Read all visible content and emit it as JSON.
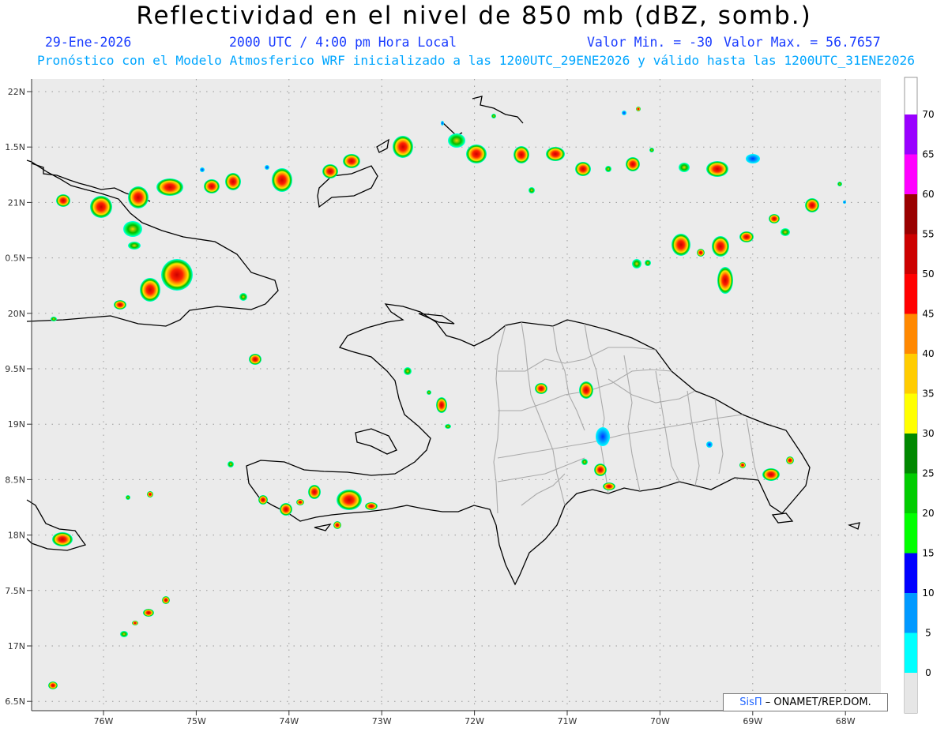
{
  "header": {
    "title": "Reflectividad en el nivel de 850 mb (dBZ, somb.)",
    "date": "29-Ene-2026",
    "time": "2000 UTC / 4:00 pm Hora Local",
    "min_label": "Valor Min. = -30",
    "max_label": "Valor Max. = 56.7657",
    "subtitle": "Pronóstico con el Modelo Atmosferico WRF inicializado a las 1200UTC_29ENE2026 y válido hasta las  1200UTC_31ENE2026"
  },
  "map": {
    "lat_ticks": [
      "22N",
      "1.5N",
      "21N",
      "0.5N",
      "20N",
      "9.5N",
      "19N",
      "8.5N",
      "18N",
      "7.5N",
      "17N",
      "6.5N"
    ],
    "lon_ticks": [
      "76W",
      "75W",
      "74W",
      "73W",
      "72W",
      "71W",
      "70W",
      "69W",
      "68W"
    ]
  },
  "colorbar": {
    "labels": [
      "0",
      "5",
      "10",
      "15",
      "20",
      "25",
      "30",
      "35",
      "40",
      "45",
      "50",
      "55",
      "60",
      "65",
      "70"
    ],
    "colors": [
      "#00ffff",
      "#0099ff",
      "#0000ff",
      "#00ff00",
      "#00cc00",
      "#008800",
      "#ffff00",
      "#ffcc00",
      "#ff8800",
      "#ff0000",
      "#cc0000",
      "#990000",
      "#ff00ff",
      "#9900ff"
    ]
  },
  "credit": {
    "logo": "SisΠ",
    "text": " – ONAMET/REP.DOM."
  }
}
